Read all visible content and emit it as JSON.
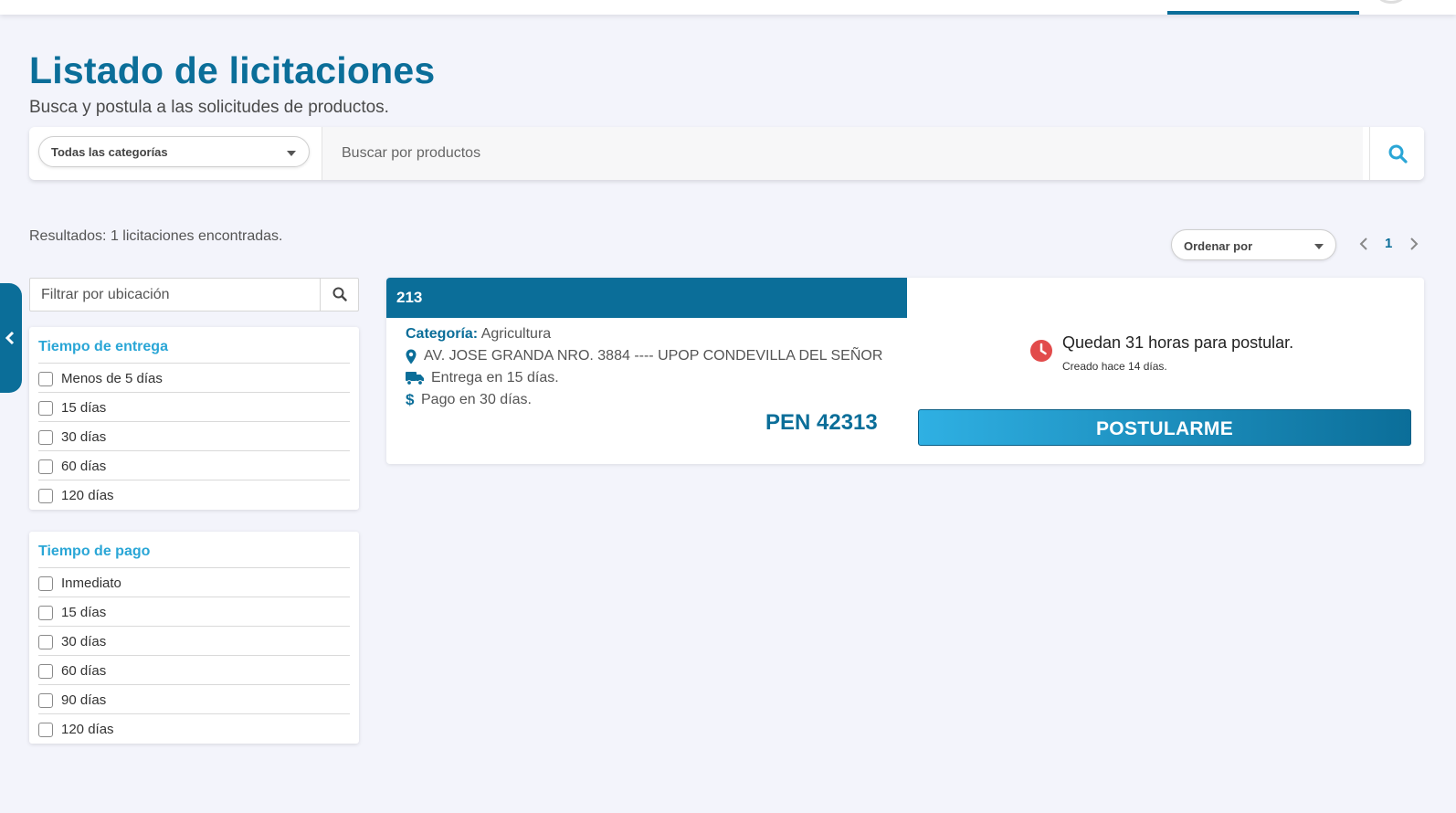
{
  "header": {
    "title": "Listado de licitaciones",
    "subtitle": "Busca y postula a las solicitudes de productos."
  },
  "search": {
    "category_selected": "Todas las categorías",
    "placeholder": "Buscar por productos"
  },
  "results": {
    "summary": "Resultados: 1 licitaciones encontradas.",
    "sort_label": "Ordenar por",
    "current_page": "1"
  },
  "filters": {
    "location_placeholder": "Filtrar por ubicación",
    "delivery": {
      "title": "Tiempo de entrega",
      "options": [
        "Menos de 5 días",
        "15 días",
        "30 días",
        "60 días",
        "120 días"
      ]
    },
    "payment": {
      "title": "Tiempo de pago",
      "options": [
        "Inmediato",
        "15 días",
        "30 días",
        "60 días",
        "90 días",
        "120 días"
      ]
    }
  },
  "tender": {
    "id": "213",
    "category_label": "Categoría:",
    "category": "Agricultura",
    "address": "AV. JOSE GRANDA NRO. 3884 ---- UPOP CONDEVILLA DEL SEÑOR",
    "delivery": "Entrega en 15 días.",
    "payment": "Pago en 30 días.",
    "price": "PEN 42313",
    "remaining": "Quedan 31 horas para postular.",
    "created": "Creado hace 14 días.",
    "apply_label": "POSTULARME"
  },
  "colors": {
    "primary": "#0b6e99",
    "accent": "#2aa6d6",
    "clock": "#e24b4b",
    "background": "#f3f4fb"
  },
  "icons": [
    "search-icon",
    "caret-down-icon",
    "chevron-left-icon",
    "chevron-right-icon",
    "map-marker-icon",
    "truck-icon",
    "dollar-icon",
    "clock-icon"
  ]
}
